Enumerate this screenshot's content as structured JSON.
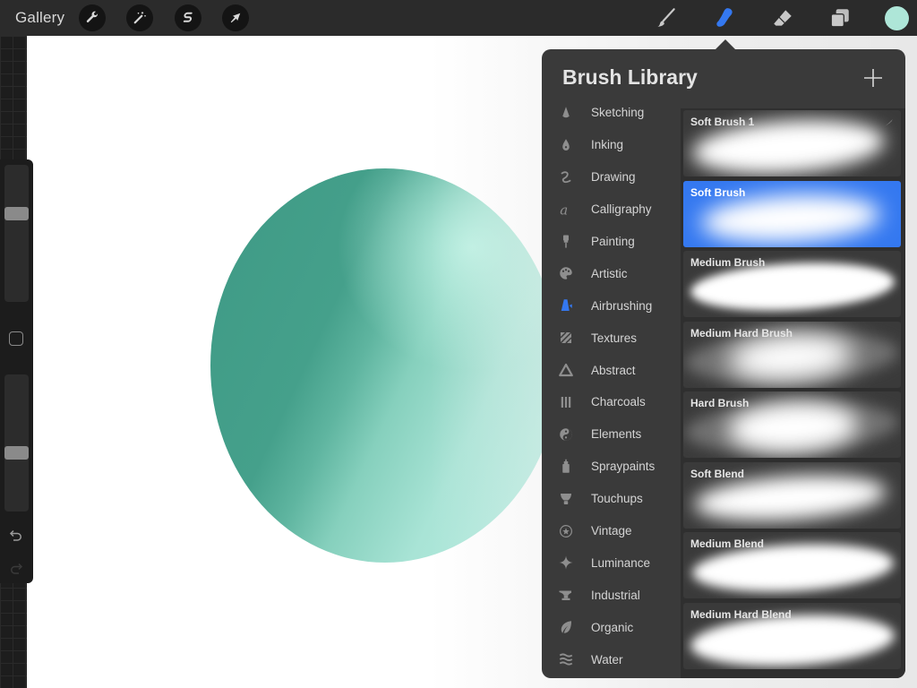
{
  "topbar": {
    "gallery_label": "Gallery",
    "left_tools": [
      {
        "name": "actions",
        "icon": "wrench-icon"
      },
      {
        "name": "adjustments",
        "icon": "magic-wand-icon"
      },
      {
        "name": "selection",
        "icon": "selection-s-icon"
      },
      {
        "name": "transform",
        "icon": "arrow-cursor-icon"
      }
    ],
    "right_tools": [
      {
        "name": "paint",
        "icon": "brush-icon",
        "active": false
      },
      {
        "name": "smudge",
        "icon": "smudge-finger-icon",
        "active": true
      },
      {
        "name": "erase",
        "icon": "eraser-icon",
        "active": false
      },
      {
        "name": "layers",
        "icon": "layers-icon",
        "active": false
      }
    ],
    "current_color": "#aee6d8",
    "active_color": "#3478f0"
  },
  "side_panel": {
    "brush_size_fraction": 0.31,
    "opacity_fraction": 0.58,
    "modifier_icon": "square-modifier-icon",
    "undo_icon": "undo-icon",
    "redo_icon": "redo-icon"
  },
  "brush_library": {
    "title": "Brush Library",
    "add_icon": "plus-icon",
    "categories": [
      {
        "label": "Sketching",
        "icon": "pencil-tip-icon",
        "active": false
      },
      {
        "label": "Inking",
        "icon": "ink-drop-icon",
        "active": false
      },
      {
        "label": "Drawing",
        "icon": "squiggle-icon",
        "active": false
      },
      {
        "label": "Calligraphy",
        "icon": "script-a-icon",
        "active": false
      },
      {
        "label": "Painting",
        "icon": "paintbrush-icon",
        "active": false
      },
      {
        "label": "Artistic",
        "icon": "palette-icon",
        "active": false
      },
      {
        "label": "Airbrushing",
        "icon": "airbrush-icon",
        "active": true
      },
      {
        "label": "Textures",
        "icon": "hatched-square-icon",
        "active": false
      },
      {
        "label": "Abstract",
        "icon": "triangle-icon",
        "active": false
      },
      {
        "label": "Charcoals",
        "icon": "charcoal-sticks-icon",
        "active": false
      },
      {
        "label": "Elements",
        "icon": "yin-yang-icon",
        "active": false
      },
      {
        "label": "Spraypaints",
        "icon": "spray-can-icon",
        "active": false
      },
      {
        "label": "Touchups",
        "icon": "makeup-brush-icon",
        "active": false
      },
      {
        "label": "Vintage",
        "icon": "star-badge-icon",
        "active": false
      },
      {
        "label": "Luminance",
        "icon": "sparkle-icon",
        "active": false
      },
      {
        "label": "Industrial",
        "icon": "anvil-icon",
        "active": false
      },
      {
        "label": "Organic",
        "icon": "leaf-icon",
        "active": false
      },
      {
        "label": "Water",
        "icon": "waves-icon",
        "active": false
      }
    ],
    "brushes": [
      {
        "name": "Soft Brush 1",
        "selected": false,
        "edited": true
      },
      {
        "name": "Soft Brush",
        "selected": true,
        "edited": false
      },
      {
        "name": "Medium Brush",
        "selected": false,
        "edited": false
      },
      {
        "name": "Medium Hard Brush",
        "selected": false,
        "edited": false
      },
      {
        "name": "Hard Brush",
        "selected": false,
        "edited": false
      },
      {
        "name": "Soft Blend",
        "selected": false,
        "edited": false
      },
      {
        "name": "Medium Blend",
        "selected": false,
        "edited": false
      },
      {
        "name": "Medium Hard Blend",
        "selected": false,
        "edited": false
      }
    ]
  }
}
